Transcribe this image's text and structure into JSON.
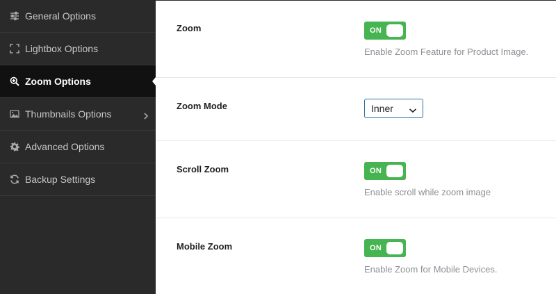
{
  "sidebar": {
    "items": [
      {
        "label": "General Options",
        "icon": "sliders-icon"
      },
      {
        "label": "Lightbox Options",
        "icon": "expand-icon"
      },
      {
        "label": "Zoom Options",
        "icon": "zoom-icon",
        "active": true
      },
      {
        "label": "Thumbnails Options",
        "icon": "image-icon",
        "has_submenu": true
      },
      {
        "label": "Advanced Options",
        "icon": "gear-icon"
      },
      {
        "label": "Backup Settings",
        "icon": "refresh-icon"
      }
    ]
  },
  "settings": {
    "zoom": {
      "label": "Zoom",
      "toggle": "ON",
      "hint": "Enable Zoom Feature for Product Image."
    },
    "zoom_mode": {
      "label": "Zoom Mode",
      "value": "Inner"
    },
    "scroll_zoom": {
      "label": "Scroll Zoom",
      "toggle": "ON",
      "hint": "Enable scroll while zoom image"
    },
    "mobile_zoom": {
      "label": "Mobile Zoom",
      "toggle": "ON",
      "hint": "Enable Zoom for Mobile Devices."
    }
  },
  "colors": {
    "sidebar_bg": "#2a2a2a",
    "sidebar_active_bg": "#111111",
    "toggle_on": "#46b450",
    "select_border": "#2d6da3"
  }
}
